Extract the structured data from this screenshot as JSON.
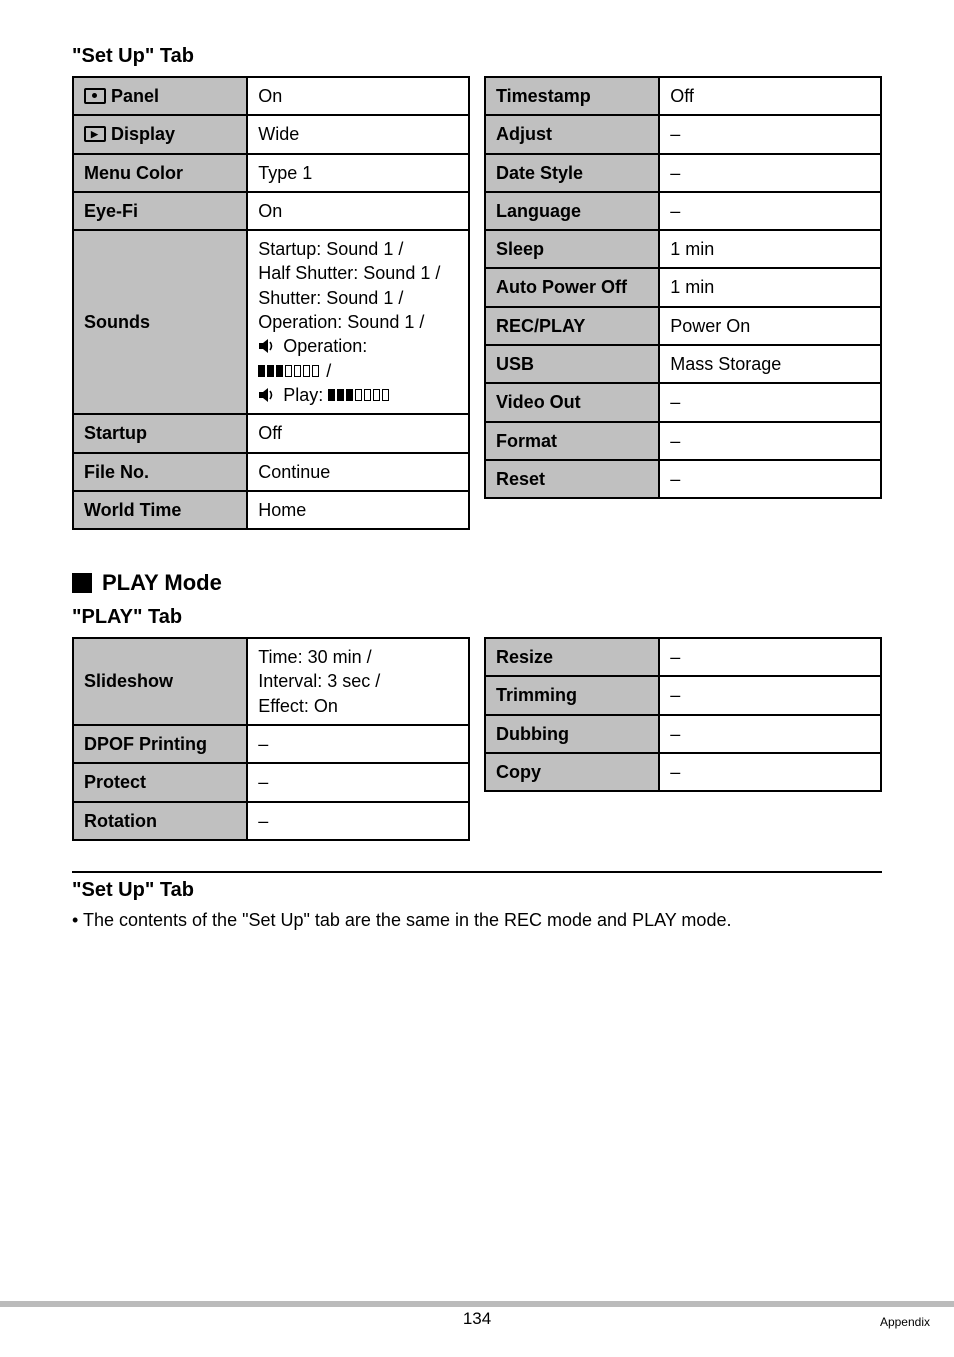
{
  "setup_tab_title": "\"Set Up\" Tab",
  "setup_left_rows": [
    {
      "icon": "panel",
      "label": "Panel",
      "value": "On"
    },
    {
      "icon": "display",
      "label": "Display",
      "value": "Wide"
    },
    {
      "icon": null,
      "label": "Menu Color",
      "value": "Type 1"
    },
    {
      "icon": null,
      "label": "Eye-Fi",
      "value": "On"
    }
  ],
  "sounds_label": "Sounds",
  "sounds_lines": {
    "startup": "Startup: Sound 1 /",
    "half": "Half Shutter: Sound 1 /",
    "shutter": "Shutter: Sound 1 /",
    "op": "Operation: Sound 1 /",
    "op_icon": " Operation:",
    "play_icon": " Play: "
  },
  "setup_left_rows_after": [
    {
      "label": "Startup",
      "value": "Off"
    },
    {
      "label": "File No.",
      "value": "Continue"
    },
    {
      "label": "World Time",
      "value": "Home"
    }
  ],
  "setup_right_rows": [
    {
      "label": "Timestamp",
      "value": "Off"
    },
    {
      "label": "Adjust",
      "value": "–"
    },
    {
      "label": "Date Style",
      "value": "–"
    },
    {
      "label": "Language",
      "value": "–"
    },
    {
      "label": "Sleep",
      "value": "1 min"
    },
    {
      "label": "Auto Power Off",
      "value": "1 min"
    },
    {
      "label": "REC/PLAY",
      "value": "Power On"
    },
    {
      "label": "USB",
      "value": "Mass Storage"
    },
    {
      "label": "Video Out",
      "value": "–"
    },
    {
      "label": "Format",
      "value": "–"
    },
    {
      "label": "Reset",
      "value": "–"
    }
  ],
  "play_mode_title": "PLAY Mode",
  "play_tab_title": "\"PLAY\" Tab",
  "play_left_rows": [
    {
      "label": "Slideshow",
      "value": "Time: 30 min /\nInterval: 3 sec /\nEffect: On"
    },
    {
      "label": "DPOF Printing",
      "value": "–"
    },
    {
      "label": "Protect",
      "value": "–"
    },
    {
      "label": "Rotation",
      "value": "–"
    }
  ],
  "play_right_rows": [
    {
      "label": "Resize",
      "value": "–"
    },
    {
      "label": "Trimming",
      "value": "–"
    },
    {
      "label": "Dubbing",
      "value": "–"
    },
    {
      "label": "Copy",
      "value": "–"
    }
  ],
  "bottom_tab_title": "\"Set Up\" Tab",
  "bottom_note": "• The contents of the \"Set Up\" tab are the same in the REC mode and PLAY mode.",
  "page_number": "134",
  "appendix_label": "Appendix"
}
